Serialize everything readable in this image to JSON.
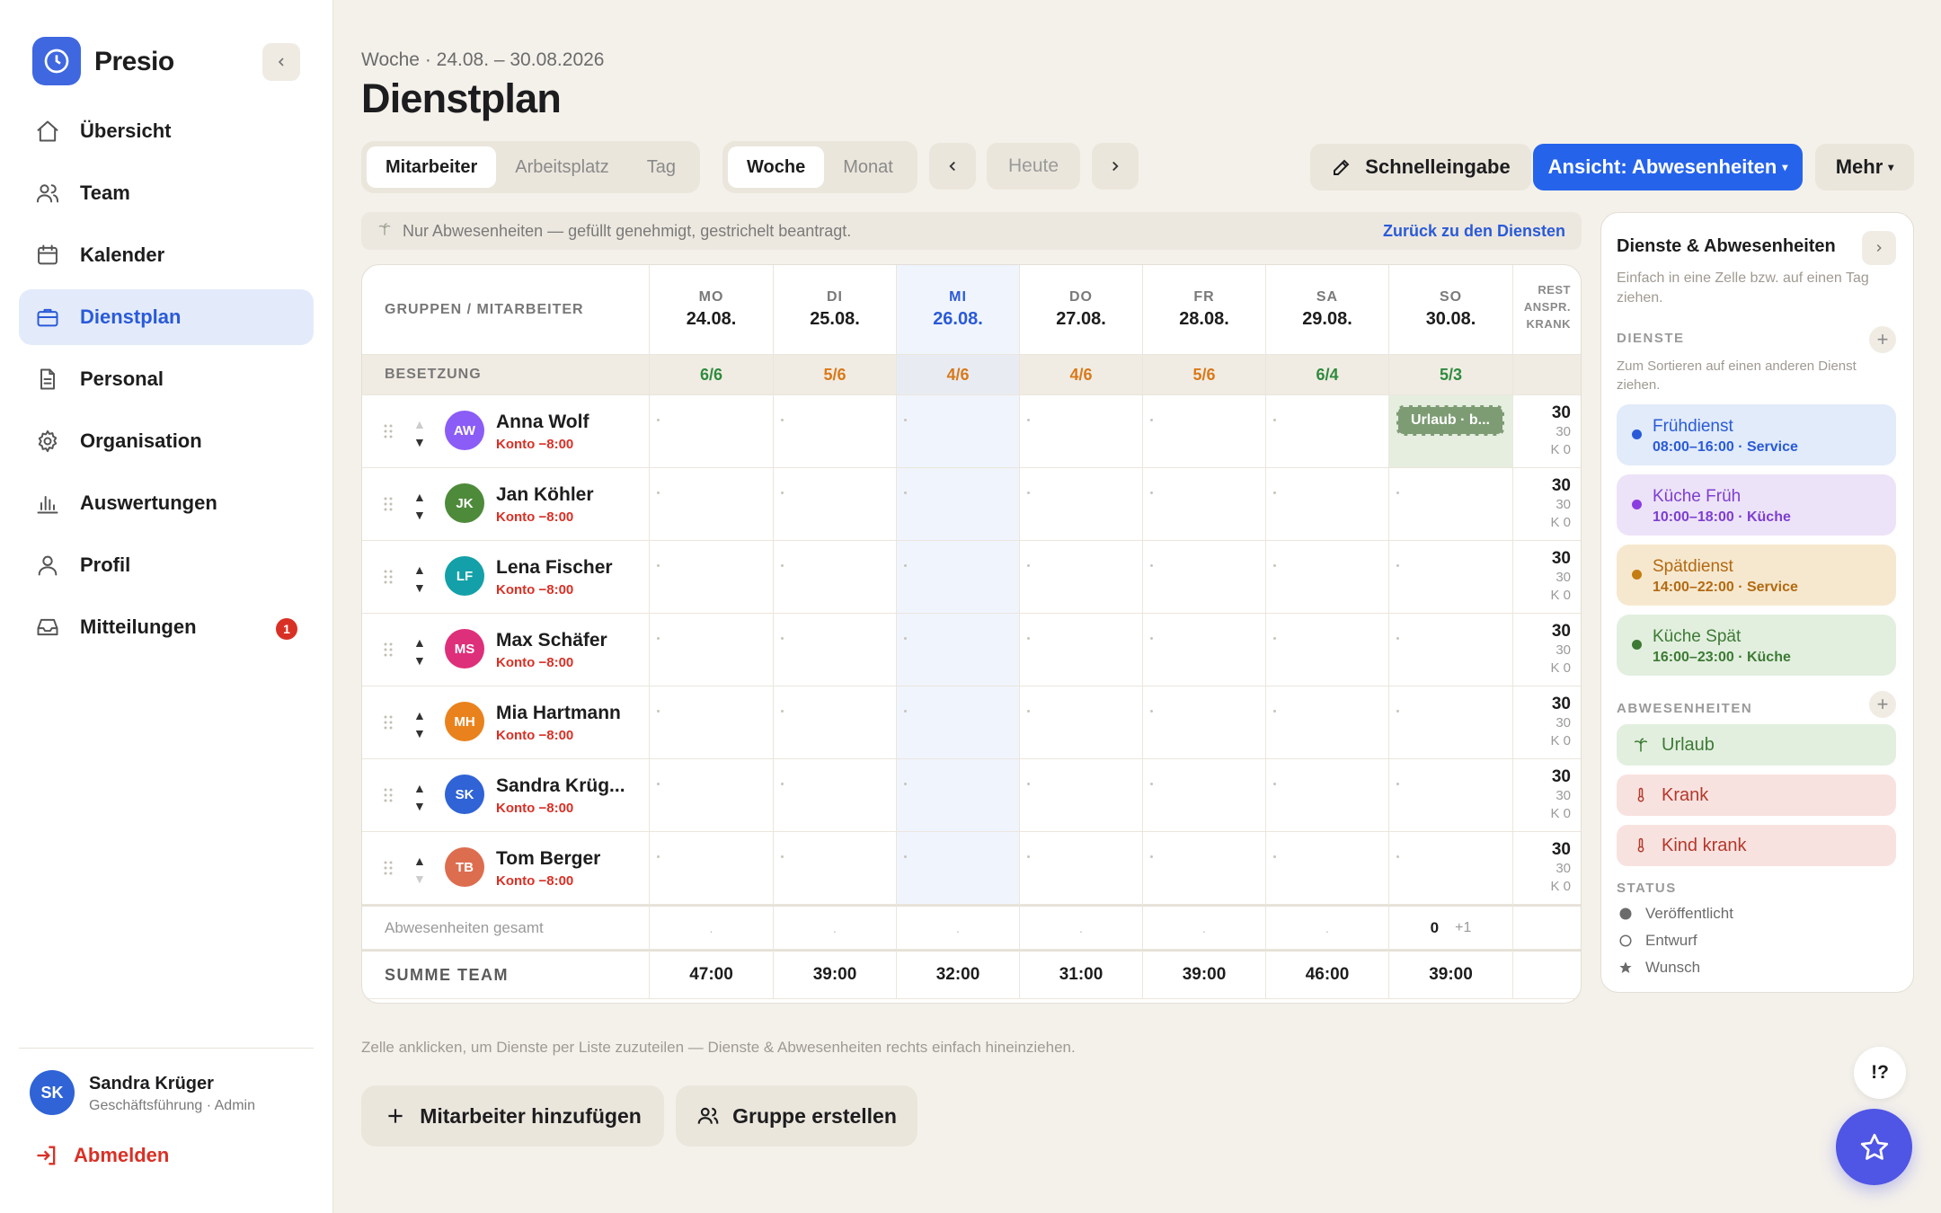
{
  "app": {
    "name": "Presio"
  },
  "nav": [
    {
      "label": "Übersicht",
      "icon": "home-icon"
    },
    {
      "label": "Team",
      "icon": "users-icon"
    },
    {
      "label": "Kalender",
      "icon": "calendar-icon"
    },
    {
      "label": "Dienstplan",
      "icon": "briefcase-icon",
      "active": true
    },
    {
      "label": "Personal",
      "icon": "document-icon"
    },
    {
      "label": "Organisation",
      "icon": "gear-icon"
    },
    {
      "label": "Auswertungen",
      "icon": "chart-icon"
    },
    {
      "label": "Profil",
      "icon": "user-icon"
    },
    {
      "label": "Mitteilungen",
      "icon": "inbox-icon",
      "badge": "1"
    }
  ],
  "user": {
    "initials": "SK",
    "name": "Sandra Krüger",
    "role": "Geschäftsführung · Admin",
    "logout": "Abmelden"
  },
  "header": {
    "subtitle": "Woche · 24.08. – 30.08.2026",
    "title": "Dienstplan"
  },
  "toolbar": {
    "group_tabs": [
      "Mitarbeiter",
      "Arbeitsplatz",
      "Tag"
    ],
    "range_tabs": [
      "Woche",
      "Monat"
    ],
    "today": "Heute",
    "quick": "Schnelleingabe",
    "view": "Ansicht: Abwesenheiten",
    "more": "Mehr"
  },
  "info": {
    "text": "Nur Abwesenheiten — gefüllt genehmigt, gestrichelt beantragt.",
    "link": "Zurück zu den Diensten"
  },
  "grid": {
    "group_header": "GRUPPEN / MITARBEITER",
    "rest_header": [
      "REST",
      "ANSPR.",
      "KRANK"
    ],
    "days": [
      {
        "name": "MO",
        "date": "24.08."
      },
      {
        "name": "DI",
        "date": "25.08."
      },
      {
        "name": "MI",
        "date": "26.08.",
        "today": true
      },
      {
        "name": "DO",
        "date": "27.08."
      },
      {
        "name": "FR",
        "date": "28.08."
      },
      {
        "name": "SA",
        "date": "29.08."
      },
      {
        "name": "SO",
        "date": "30.08."
      }
    ],
    "staffing_label": "BESETZUNG",
    "staffing": [
      {
        "value": "6/6",
        "color": "#2e8b3e"
      },
      {
        "value": "5/6",
        "color": "#d9791a"
      },
      {
        "value": "4/6",
        "color": "#d9791a"
      },
      {
        "value": "4/6",
        "color": "#d9791a"
      },
      {
        "value": "5/6",
        "color": "#d9791a"
      },
      {
        "value": "6/4",
        "color": "#2e8b3e"
      },
      {
        "value": "5/3",
        "color": "#2e8b3e"
      }
    ],
    "employees": [
      {
        "initials": "AW",
        "name": "Anna Wolf",
        "konto": "Konto −8:00",
        "color": "#8b5cf6",
        "rest": "30",
        "anspr": "30",
        "krank": "K 0",
        "absence": {
          "day": 6,
          "label": "Urlaub · b..."
        }
      },
      {
        "initials": "JK",
        "name": "Jan Köhler",
        "konto": "Konto −8:00",
        "color": "#4d8a3a",
        "rest": "30",
        "anspr": "30",
        "krank": "K 0"
      },
      {
        "initials": "LF",
        "name": "Lena Fischer",
        "konto": "Konto −8:00",
        "color": "#14a0a8",
        "rest": "30",
        "anspr": "30",
        "krank": "K 0"
      },
      {
        "initials": "MS",
        "name": "Max Schäfer",
        "konto": "Konto −8:00",
        "color": "#de2f7a",
        "rest": "30",
        "anspr": "30",
        "krank": "K 0"
      },
      {
        "initials": "MH",
        "name": "Mia Hartmann",
        "konto": "Konto −8:00",
        "color": "#e9821d",
        "rest": "30",
        "anspr": "30",
        "krank": "K 0"
      },
      {
        "initials": "SK",
        "name": "Sandra Krüg...",
        "konto": "Konto −8:00",
        "color": "#2f63d6",
        "rest": "30",
        "anspr": "30",
        "krank": "K 0"
      },
      {
        "initials": "TB",
        "name": "Tom Berger",
        "konto": "Konto −8:00",
        "color": "#dd6d4f",
        "rest": "30",
        "anspr": "30",
        "krank": "K 0"
      }
    ],
    "absences_label": "Abwesenheiten gesamt",
    "absences": [
      ".",
      ".",
      ".",
      ".",
      ".",
      ".",
      ""
    ],
    "absences_sun": {
      "count": "0",
      "extra": "+1"
    },
    "sum_label": "SUMME TEAM",
    "sums": [
      "47:00",
      "39:00",
      "32:00",
      "31:00",
      "39:00",
      "46:00",
      "39:00"
    ]
  },
  "hint": "Zelle anklicken, um Dienste per Liste zuzuteilen — Dienste & Abwesenheiten rechts einfach hineinziehen.",
  "actions": {
    "add_employee": "Mitarbeiter hinzufügen",
    "create_group": "Gruppe erstellen"
  },
  "panel": {
    "title": "Dienste & Abwesenheiten",
    "desc": "Einfach in eine Zelle bzw. auf einen Tag ziehen.",
    "services_label": "DIENSTE",
    "services_hint": "Zum Sortieren auf einen anderen Dienst ziehen.",
    "services": [
      {
        "name": "Frühdienst",
        "time": "08:00–16:00 · Service",
        "bg": "#e1ebf9",
        "fg": "#2a5ad8",
        "dot": "#2a5ad8"
      },
      {
        "name": "Küche Früh",
        "time": "10:00–18:00 · Küche",
        "bg": "#ede3f8",
        "fg": "#7d3ed1",
        "dot": "#8b3ee0"
      },
      {
        "name": "Spätdienst",
        "time": "14:00–22:00 · Service",
        "bg": "#f6e8cf",
        "fg": "#b26a12",
        "dot": "#c47d12"
      },
      {
        "name": "Küche Spät",
        "time": "16:00–23:00 · Küche",
        "bg": "#e2efdf",
        "fg": "#3d7a34",
        "dot": "#3d7a34"
      }
    ],
    "absences_label": "ABWESENHEITEN",
    "absences": [
      {
        "name": "Urlaub",
        "bg": "#e2efdf",
        "fg": "#3d7a34",
        "icon": "palm-icon"
      },
      {
        "name": "Krank",
        "bg": "#f8e2df",
        "fg": "#b4382b",
        "icon": "thermometer-icon"
      },
      {
        "name": "Kind krank",
        "bg": "#f8e2df",
        "fg": "#b4382b",
        "icon": "thermometer-icon"
      }
    ],
    "status_label": "STATUS",
    "status": [
      "Veröffentlicht",
      "Entwurf",
      "Wunsch"
    ]
  },
  "help": "!?"
}
